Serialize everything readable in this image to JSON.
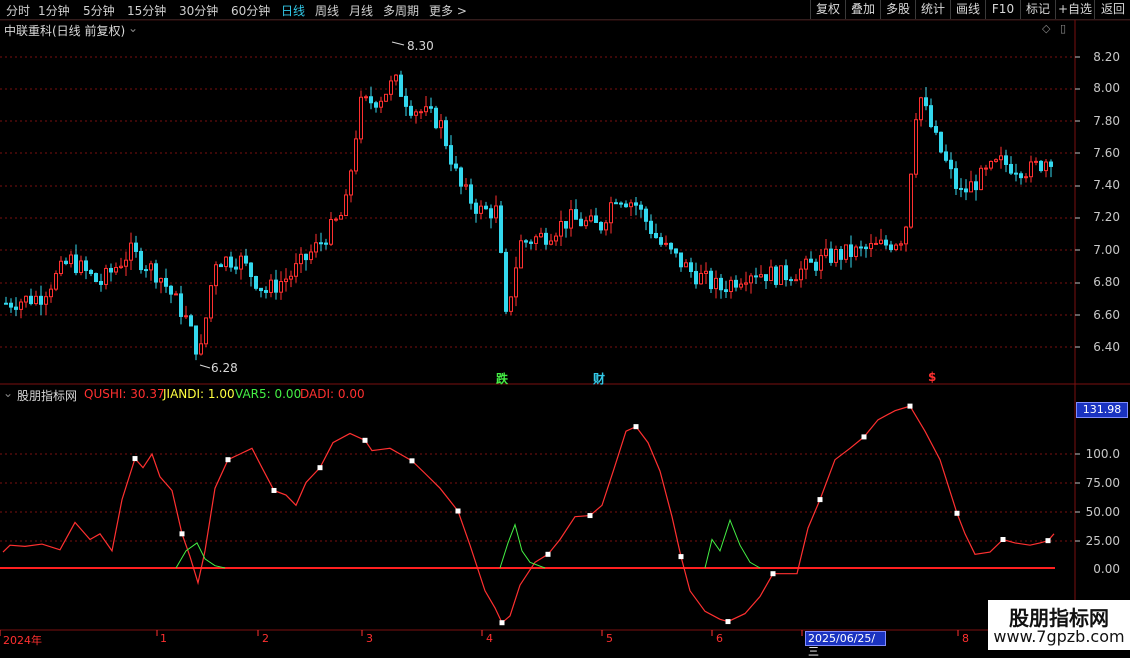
{
  "toolbar": {
    "timeframes": [
      "分时",
      "1分钟",
      "5分钟",
      "15分钟",
      "30分钟",
      "60分钟",
      "日线",
      "周线",
      "月线",
      "多周期",
      "更多"
    ],
    "active_timeframe": "日线",
    "right_buttons": [
      "复权",
      "叠加",
      "多股",
      "统计",
      "画线",
      "F10",
      "标记",
      "+自选",
      "返回"
    ]
  },
  "main_chart": {
    "title": "中联重科(日线 前复权)",
    "high_label": "8.30",
    "low_label": "6.28",
    "event_markers": [
      {
        "text": "跌",
        "color": "#44ee44"
      },
      {
        "text": "财",
        "color": "#33c9e8"
      },
      {
        "text": "$",
        "color": "#ff3030"
      }
    ],
    "y_ticks": [
      "8.20",
      "8.00",
      "7.80",
      "7.60",
      "7.40",
      "7.20",
      "7.00",
      "6.80",
      "6.60",
      "6.40"
    ]
  },
  "indicator": {
    "name": "股朋指标网",
    "values": [
      {
        "label": "QUSHI: 30.37",
        "color": "#ff3030"
      },
      {
        "label": "JIANDI: 1.00",
        "color": "#ffff40"
      },
      {
        "label": "VAR5: 0.00",
        "color": "#44ee44"
      },
      {
        "label": "DADI: 0.00",
        "color": "#ff3030"
      }
    ],
    "current_value": "131.98",
    "y_ticks": [
      "100.0",
      "75.00",
      "50.00",
      "25.00",
      "0.00"
    ]
  },
  "time_axis": {
    "labels": [
      "2024年",
      "1",
      "2",
      "3",
      "4",
      "5",
      "6",
      "8"
    ],
    "cursor_date": "2025/06/25/三"
  },
  "watermark": {
    "title": "股朋指标网",
    "url": "www.7gpzb.com"
  },
  "colors": {
    "up": "#ff3030",
    "down": "#33d8ee",
    "grid": "#7a1010",
    "indicator_line": "#ff3030",
    "var5_line": "#44ee44"
  }
}
